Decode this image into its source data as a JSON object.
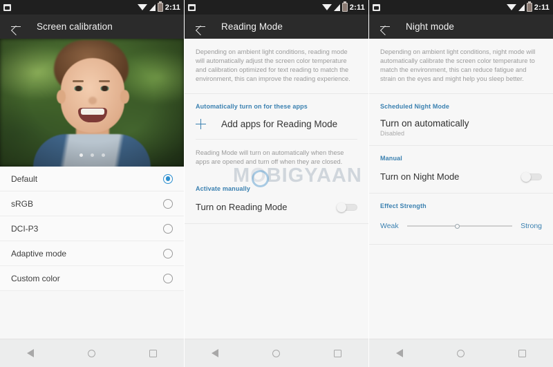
{
  "statusbar": {
    "notification_icon": "screenshot-icon",
    "wifi_icon": "wifi-icon",
    "signal_icon": "signal-icon",
    "battery_icon": "battery-icon",
    "time": "2:11"
  },
  "navbar": {
    "back": "back-triangle-icon",
    "home": "home-circle-icon",
    "recents": "recents-square-icon"
  },
  "watermark": {
    "text_before": "M",
    "text_o": "O",
    "text_after": "BIGYAAN"
  },
  "colors": {
    "accent_blue": "#3a80b0",
    "radio_selected": "#2b8fd0",
    "appbar": "#2b2b2b",
    "statusbar": "#1f1f1f",
    "page_bg": "#f7f7f7"
  },
  "screen1": {
    "title": "Screen calibration",
    "back_icon": "back-arrow-icon",
    "photo_dots": 3,
    "options": [
      {
        "label": "Default",
        "selected": true
      },
      {
        "label": "sRGB",
        "selected": false
      },
      {
        "label": "DCI-P3",
        "selected": false
      },
      {
        "label": "Adaptive mode",
        "selected": false
      },
      {
        "label": "Custom color",
        "selected": false
      }
    ]
  },
  "screen2": {
    "title": "Reading Mode",
    "back_icon": "back-arrow-icon",
    "description": "Depending on ambient light conditions, reading mode will automatically adjust the screen color temperature and calibration optimized for text reading to match the environment, this can improve the reading experience.",
    "section_auto": "Automatically turn on for these apps",
    "add_apps_label": "Add apps for Reading Mode",
    "add_apps_icon": "plus-icon",
    "auto_hint": "Reading Mode will turn on automatically when these apps are opened and turn off when they are closed.",
    "section_manual": "Activate manually",
    "toggle_label": "Turn on Reading Mode",
    "toggle_state": "off"
  },
  "screen3": {
    "title": "Night mode",
    "back_icon": "back-arrow-icon",
    "description": "Depending on ambient light conditions, night mode will automatically calibrate the screen color temperature to match the environment, this can reduce fatigue and strain on the eyes and might help you sleep better.",
    "section_scheduled": "Scheduled Night Mode",
    "auto_title": "Turn on automatically",
    "auto_sub": "Disabled",
    "section_manual": "Manual",
    "toggle_label": "Turn on Night Mode",
    "toggle_state": "off",
    "section_effect": "Effect Strength",
    "slider_min_label": "Weak",
    "slider_max_label": "Strong",
    "slider_value": 48
  }
}
